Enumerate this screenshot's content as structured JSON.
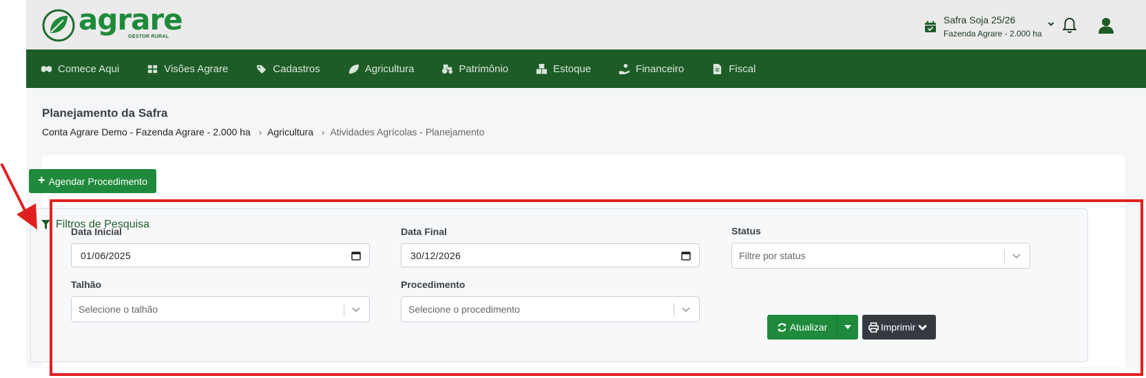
{
  "brand": {
    "name": "agrare",
    "tagline": "GESTOR RURAL",
    "color": "#1f8a3b"
  },
  "header": {
    "season_title": "Safra Soja 25/26",
    "season_subtitle": "Fazenda Agrare - 2.000 ha",
    "icons": [
      "calendar-check-icon",
      "chevron-down-icon",
      "bell-icon",
      "user-avatar-icon"
    ]
  },
  "nav": {
    "color": "#1e5c27",
    "items": [
      {
        "label": "Comece Aqui",
        "icon": "handshake-icon"
      },
      {
        "label": "Visões Agrare",
        "icon": "grid-icon"
      },
      {
        "label": "Cadastros",
        "icon": "tags-icon"
      },
      {
        "label": "Agricultura",
        "icon": "leaf-icon"
      },
      {
        "label": "Patrimônio",
        "icon": "tractor-icon"
      },
      {
        "label": "Estoque",
        "icon": "boxes-icon"
      },
      {
        "label": "Financeiro",
        "icon": "hand-coin-icon"
      },
      {
        "label": "Fiscal",
        "icon": "invoice-icon"
      }
    ]
  },
  "page": {
    "title": "Planejamento da Safra",
    "breadcrumb": [
      "Conta Agrare Demo - Fazenda Agrare - 2.000 ha",
      "Agricultura",
      "Atividades Agrícolas - Planejamento"
    ]
  },
  "actions": {
    "schedule_label": "Agendar Procedimento"
  },
  "filters": {
    "title": "Filtros de Pesquisa",
    "start_date_label": "Data Inicial",
    "start_date_value": "01/06/2025",
    "end_date_label": "Data Final",
    "end_date_value": "30/12/2026",
    "status_label": "Status",
    "status_placeholder": "Filtre por status",
    "plot_label": "Talhão",
    "plot_placeholder": "Selecione o talhão",
    "procedure_label": "Procedimento",
    "procedure_placeholder": "Selecione o procedimento",
    "refresh_label": "Atualizar",
    "print_label": "Imprimir"
  },
  "annotation": {
    "highlight_color": "#e02020"
  }
}
